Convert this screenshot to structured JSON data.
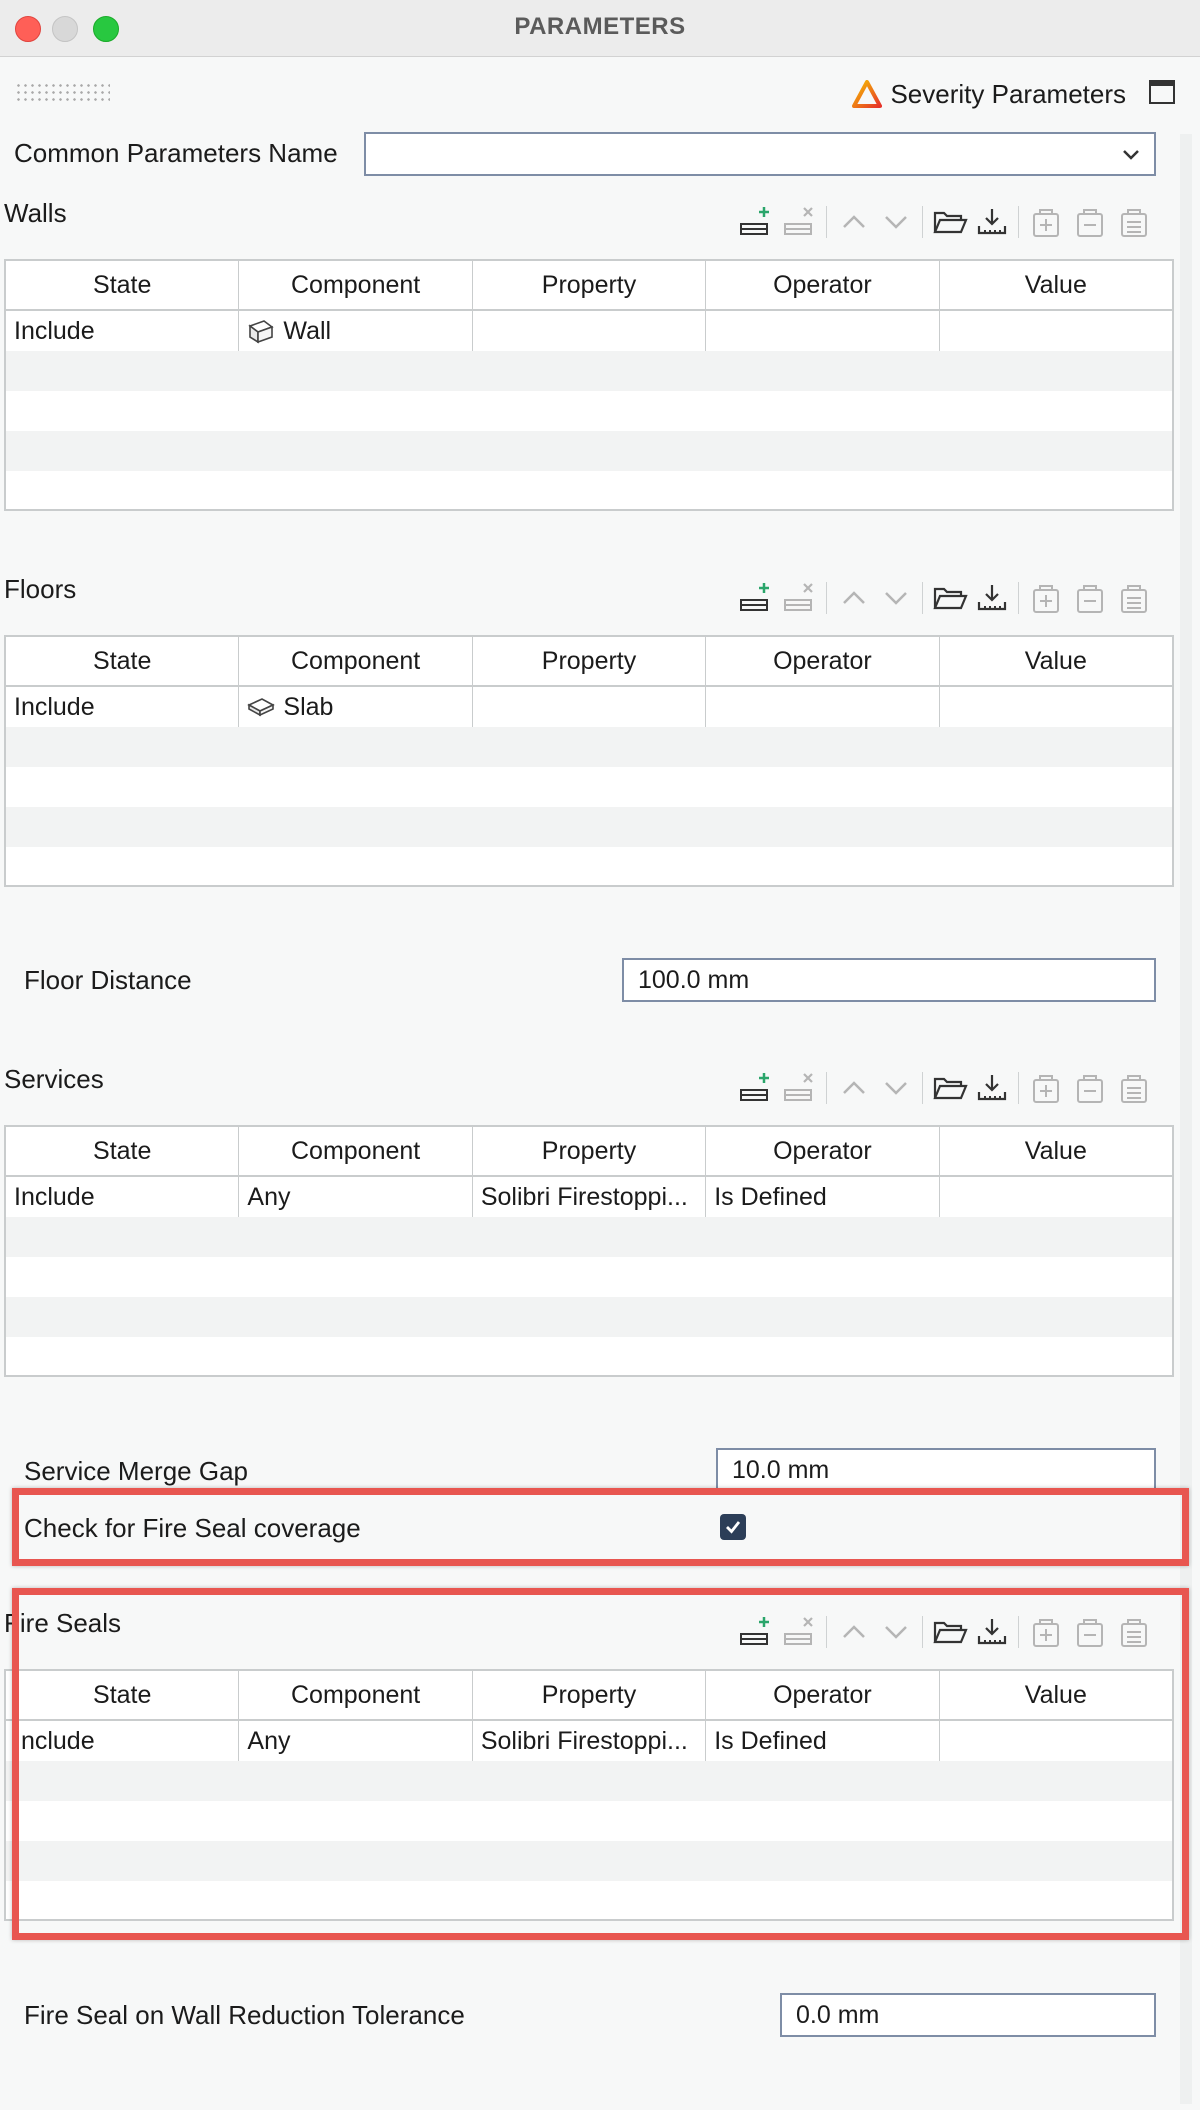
{
  "window": {
    "title": "PARAMETERS"
  },
  "header": {
    "severity_label": "Severity Parameters",
    "severity_icon": "warning-triangle-icon",
    "window_icon": "window-layout-icon"
  },
  "common": {
    "label": "Common Parameters Name",
    "value": ""
  },
  "columns": [
    "State",
    "Component",
    "Property",
    "Operator",
    "Value"
  ],
  "walls": {
    "title": "Walls",
    "rows": [
      {
        "state": "Include",
        "component": "Wall",
        "component_icon": "wall-icon",
        "property": "",
        "operator": "",
        "value": ""
      }
    ]
  },
  "floors": {
    "title": "Floors",
    "rows": [
      {
        "state": "Include",
        "component": "Slab",
        "component_icon": "slab-icon",
        "property": "",
        "operator": "",
        "value": ""
      }
    ]
  },
  "floor_distance": {
    "label": "Floor Distance",
    "value": "100.0 mm"
  },
  "services": {
    "title": "Services",
    "rows": [
      {
        "state": "Include",
        "component": "Any",
        "property": "Solibri Firestoppi...",
        "operator": "Is Defined",
        "value": ""
      }
    ]
  },
  "service_merge_gap": {
    "label": "Service Merge Gap",
    "value": "10.0 mm"
  },
  "fire_seal_check": {
    "label": "Check for Fire Seal coverage",
    "checked": true
  },
  "fire_seals": {
    "title": "Fire Seals",
    "rows": [
      {
        "state": "Include",
        "component": "Any",
        "property": "Solibri Firestoppi...",
        "operator": "Is Defined",
        "value": ""
      }
    ]
  },
  "reduction_tolerance": {
    "label": "Fire Seal on Wall Reduction Tolerance",
    "value": "0.0 mm"
  },
  "toolbar_icons": [
    "add-row-icon",
    "remove-row-icon",
    "move-up-icon",
    "move-down-icon",
    "open-folder-icon",
    "download-icon",
    "add-group-icon",
    "remove-group-icon",
    "clear-group-icon"
  ],
  "colors": {
    "highlight": "#e85650",
    "checkbox": "#2c3e58",
    "field_border": "#7e8da6"
  }
}
